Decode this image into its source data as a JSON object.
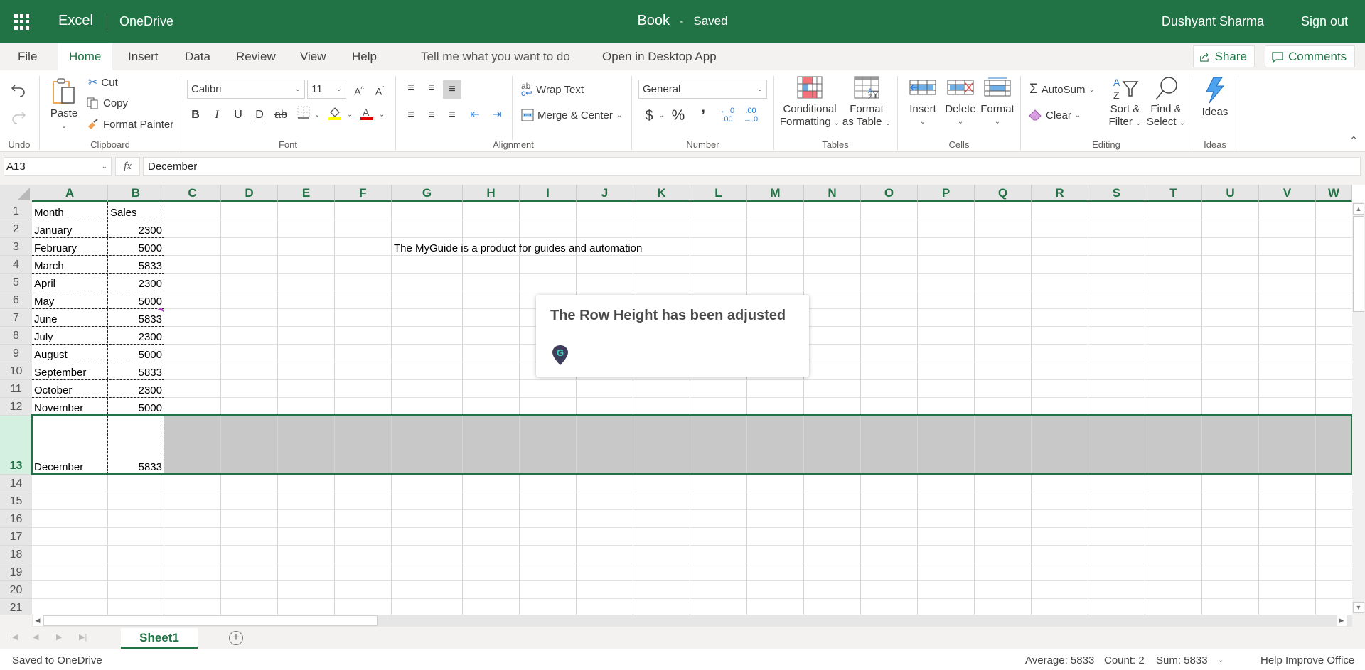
{
  "titlebar": {
    "app_name": "Excel",
    "location": "OneDrive",
    "doc_name": "Book",
    "separator": "-",
    "save_status": "Saved",
    "user_name": "Dushyant Sharma",
    "sign_out": "Sign out"
  },
  "tabs": [
    {
      "label": "File"
    },
    {
      "label": "Home",
      "active": true
    },
    {
      "label": "Insert"
    },
    {
      "label": "Data"
    },
    {
      "label": "Review"
    },
    {
      "label": "View"
    },
    {
      "label": "Help"
    }
  ],
  "tell_me": "Tell me what you want to do",
  "open_desktop": "Open in Desktop App",
  "share_label": "Share",
  "comments_label": "Comments",
  "ribbon": {
    "groups": {
      "undo": "Undo",
      "clipboard": "Clipboard",
      "font": "Font",
      "alignment": "Alignment",
      "number": "Number",
      "tables": "Tables",
      "cells": "Cells",
      "editing": "Editing",
      "ideas": "Ideas"
    },
    "paste": "Paste",
    "cut": "Cut",
    "copy": "Copy",
    "format_painter": "Format Painter",
    "font_name": "Calibri",
    "font_size": "11",
    "wrap_text": "Wrap Text",
    "merge_center": "Merge & Center",
    "number_format": "General",
    "conditional_formatting_1": "Conditional",
    "conditional_formatting_2": "Formatting",
    "format_as_table_1": "Format",
    "format_as_table_2": "as Table",
    "insert": "Insert",
    "delete": "Delete",
    "format": "Format",
    "autosum": "AutoSum",
    "clear": "Clear",
    "sort_filter_1": "Sort &",
    "sort_filter_2": "Filter",
    "find_select_1": "Find &",
    "find_select_2": "Select",
    "ideas": "Ideas"
  },
  "formula_bar": {
    "name_box": "A13",
    "fx": "fx",
    "value": "December"
  },
  "columns": [
    "A",
    "B",
    "C",
    "D",
    "E",
    "F",
    "G",
    "H",
    "I",
    "J",
    "K",
    "L",
    "M",
    "N",
    "O",
    "P",
    "Q",
    "R",
    "S",
    "T",
    "U",
    "V",
    "W"
  ],
  "rows": [
    "1",
    "2",
    "3",
    "4",
    "5",
    "6",
    "7",
    "8",
    "9",
    "10",
    "11",
    "12",
    "13",
    "14",
    "15",
    "16",
    "17",
    "18",
    "19",
    "20",
    "21"
  ],
  "cells": {
    "A1": "Month",
    "B1": "Sales",
    "A2": "January",
    "B2": "2300",
    "A3": "February",
    "B3": "5000",
    "A4": "March",
    "B4": "5833",
    "A5": "April",
    "B5": "2300",
    "A6": "May",
    "B6": "5000",
    "A7": "June",
    "B7": "5833",
    "A8": "July",
    "B8": "2300",
    "A9": "August",
    "B9": "5000",
    "A10": "September",
    "B10": "5833",
    "A11": "October",
    "B11": "2300",
    "A12": "November",
    "B12": "5000",
    "A13": "December",
    "B13": "5833",
    "G3": "The MyGuide is a product for guides and automation"
  },
  "selected_row": "13",
  "sheet_tabs": [
    {
      "label": "Sheet1",
      "active": true
    }
  ],
  "status": {
    "left": "Saved to OneDrive",
    "average": "Average: 5833",
    "count": "Count: 2",
    "sum": "Sum: 5833",
    "help": "Help Improve Office"
  },
  "popup": {
    "message": "The Row Height has been adjusted",
    "logo_letter": "G"
  },
  "colors": {
    "brand": "#217346",
    "selection_fill": "#c8c8c8",
    "popup_logo": "#3d3f5c",
    "popup_logo_letter": "#3fd6c0"
  }
}
